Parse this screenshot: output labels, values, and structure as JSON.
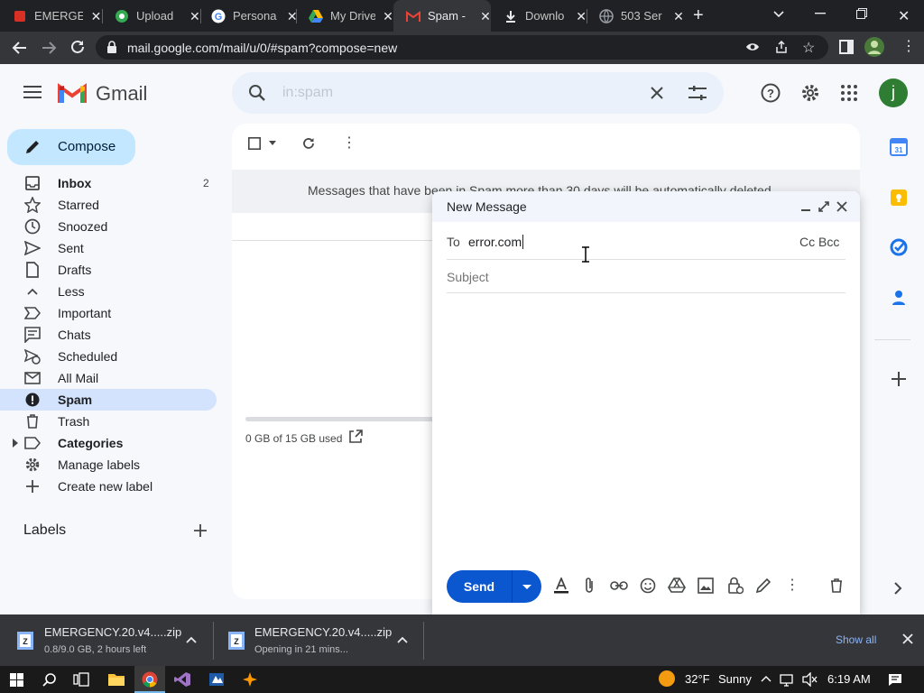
{
  "browser": {
    "tabs": [
      {
        "title": "EMERGE",
        "icon": "red-square-icon"
      },
      {
        "title": "Upload",
        "icon": "cloud-icon"
      },
      {
        "title": "Persona",
        "icon": "google-icon"
      },
      {
        "title": "My Drive",
        "icon": "drive-icon"
      },
      {
        "title": "Spam -",
        "icon": "gmail-icon"
      },
      {
        "title": "Downlo",
        "icon": "download-icon"
      },
      {
        "title": "503 Ser",
        "icon": "globe-icon"
      }
    ],
    "url": "mail.google.com/mail/u/0/#spam?compose=new",
    "profile_initial": "j"
  },
  "gmail": {
    "logo_text": "Gmail",
    "search_placeholder": "in:spam",
    "compose_label": "Compose",
    "nav": [
      {
        "label": "Inbox",
        "count": "2",
        "bold": true
      },
      {
        "label": "Starred"
      },
      {
        "label": "Snoozed"
      },
      {
        "label": "Sent"
      },
      {
        "label": "Drafts"
      },
      {
        "label": "Less"
      },
      {
        "label": "Important"
      },
      {
        "label": "Chats"
      },
      {
        "label": "Scheduled"
      },
      {
        "label": "All Mail"
      },
      {
        "label": "Spam",
        "active": true
      },
      {
        "label": "Trash"
      },
      {
        "label": "Categories",
        "bold": true
      },
      {
        "label": "Manage labels"
      },
      {
        "label": "Create new label"
      }
    ],
    "labels_heading": "Labels",
    "spam_notice": "Messages that have been in Spam more than 30 days will be automatically deleted.",
    "storage": "0 GB of 15 GB used",
    "profile_initial": "j"
  },
  "compose": {
    "title": "New Message",
    "to_label": "To",
    "to_value": "error.com",
    "cc_bcc": "Cc Bcc",
    "subject_placeholder": "Subject",
    "send_label": "Send"
  },
  "downloads": {
    "items": [
      {
        "name": "EMERGENCY.20.v4.....zip",
        "status": "0.8/9.0 GB, 2 hours left"
      },
      {
        "name": "EMERGENCY.20.v4.....zip",
        "status": "Opening in 21 mins..."
      }
    ],
    "show_all": "Show all"
  },
  "taskbar": {
    "temperature": "32°F",
    "weather": "Sunny",
    "time": "6:19 AM"
  },
  "colors": {
    "accent_blue": "#0b57d0",
    "compose_bg": "#c2e7ff",
    "active_nav": "#d3e3fd",
    "avatar": "#2e7d32"
  }
}
